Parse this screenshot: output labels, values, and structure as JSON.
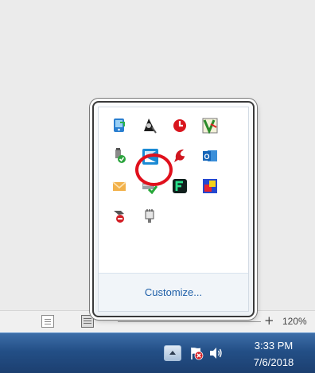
{
  "overflow_popup": {
    "icons": [
      {
        "name": "phone-sync-icon"
      },
      {
        "name": "security-tray-icon"
      },
      {
        "name": "red-clock-icon"
      },
      {
        "name": "v-app-icon"
      },
      {
        "name": "usb-device-icon"
      },
      {
        "name": "kaspersky-like-icon"
      },
      {
        "name": "red-bird-icon"
      },
      {
        "name": "outlook-icon"
      },
      {
        "name": "mail-icon"
      },
      {
        "name": "drive-check-icon"
      },
      {
        "name": "green-f-icon"
      },
      {
        "name": "color-app-icon"
      },
      {
        "name": "stop-usb-icon"
      },
      {
        "name": "network-plug-icon"
      }
    ],
    "customize_label": "Customize..."
  },
  "statusbar": {
    "zoom_plus": "+",
    "zoom_level": "120%"
  },
  "taskbar": {
    "clock_time": "3:33 PM",
    "clock_date": "7/6/2018"
  },
  "colors": {
    "highlight": "#e0101c",
    "taskbar": "#234f86",
    "link": "#1e5fa8"
  }
}
